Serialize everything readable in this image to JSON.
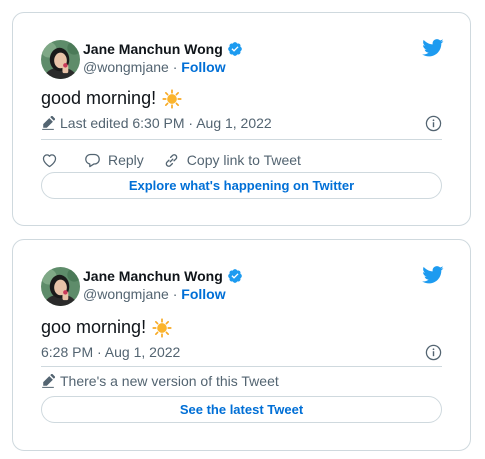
{
  "colors": {
    "link": "#006fd6",
    "muted": "#536471",
    "text": "#0f1419",
    "border": "#cfd9de",
    "verified": "#1d9bf0",
    "twitter": "#1d9bf0"
  },
  "tweet1": {
    "author_name": "Jane Manchun Wong",
    "handle": "@wongmjane",
    "separator": "·",
    "follow_label": "Follow",
    "text": "good morning!",
    "meta_text": "Last edited 6:30 PM · Aug 1, 2022",
    "actions": {
      "reply_label": "Reply",
      "copy_label": "Copy link to Tweet"
    },
    "cta_label": "Explore what's happening on Twitter",
    "icons": [
      "verified-badge-icon",
      "twitter-bird-icon",
      "sun-emoji-icon",
      "pencil-icon",
      "info-icon",
      "heart-icon",
      "reply-icon",
      "link-icon"
    ]
  },
  "tweet2": {
    "author_name": "Jane Manchun Wong",
    "handle": "@wongmjane",
    "separator": "·",
    "follow_label": "Follow",
    "text": "goo morning!",
    "meta_text": "6:28 PM · Aug 1, 2022",
    "notice_text": "There's a new version of this Tweet",
    "cta_label": "See the latest Tweet",
    "icons": [
      "verified-badge-icon",
      "twitter-bird-icon",
      "sun-emoji-icon",
      "info-icon",
      "pencil-icon"
    ]
  }
}
